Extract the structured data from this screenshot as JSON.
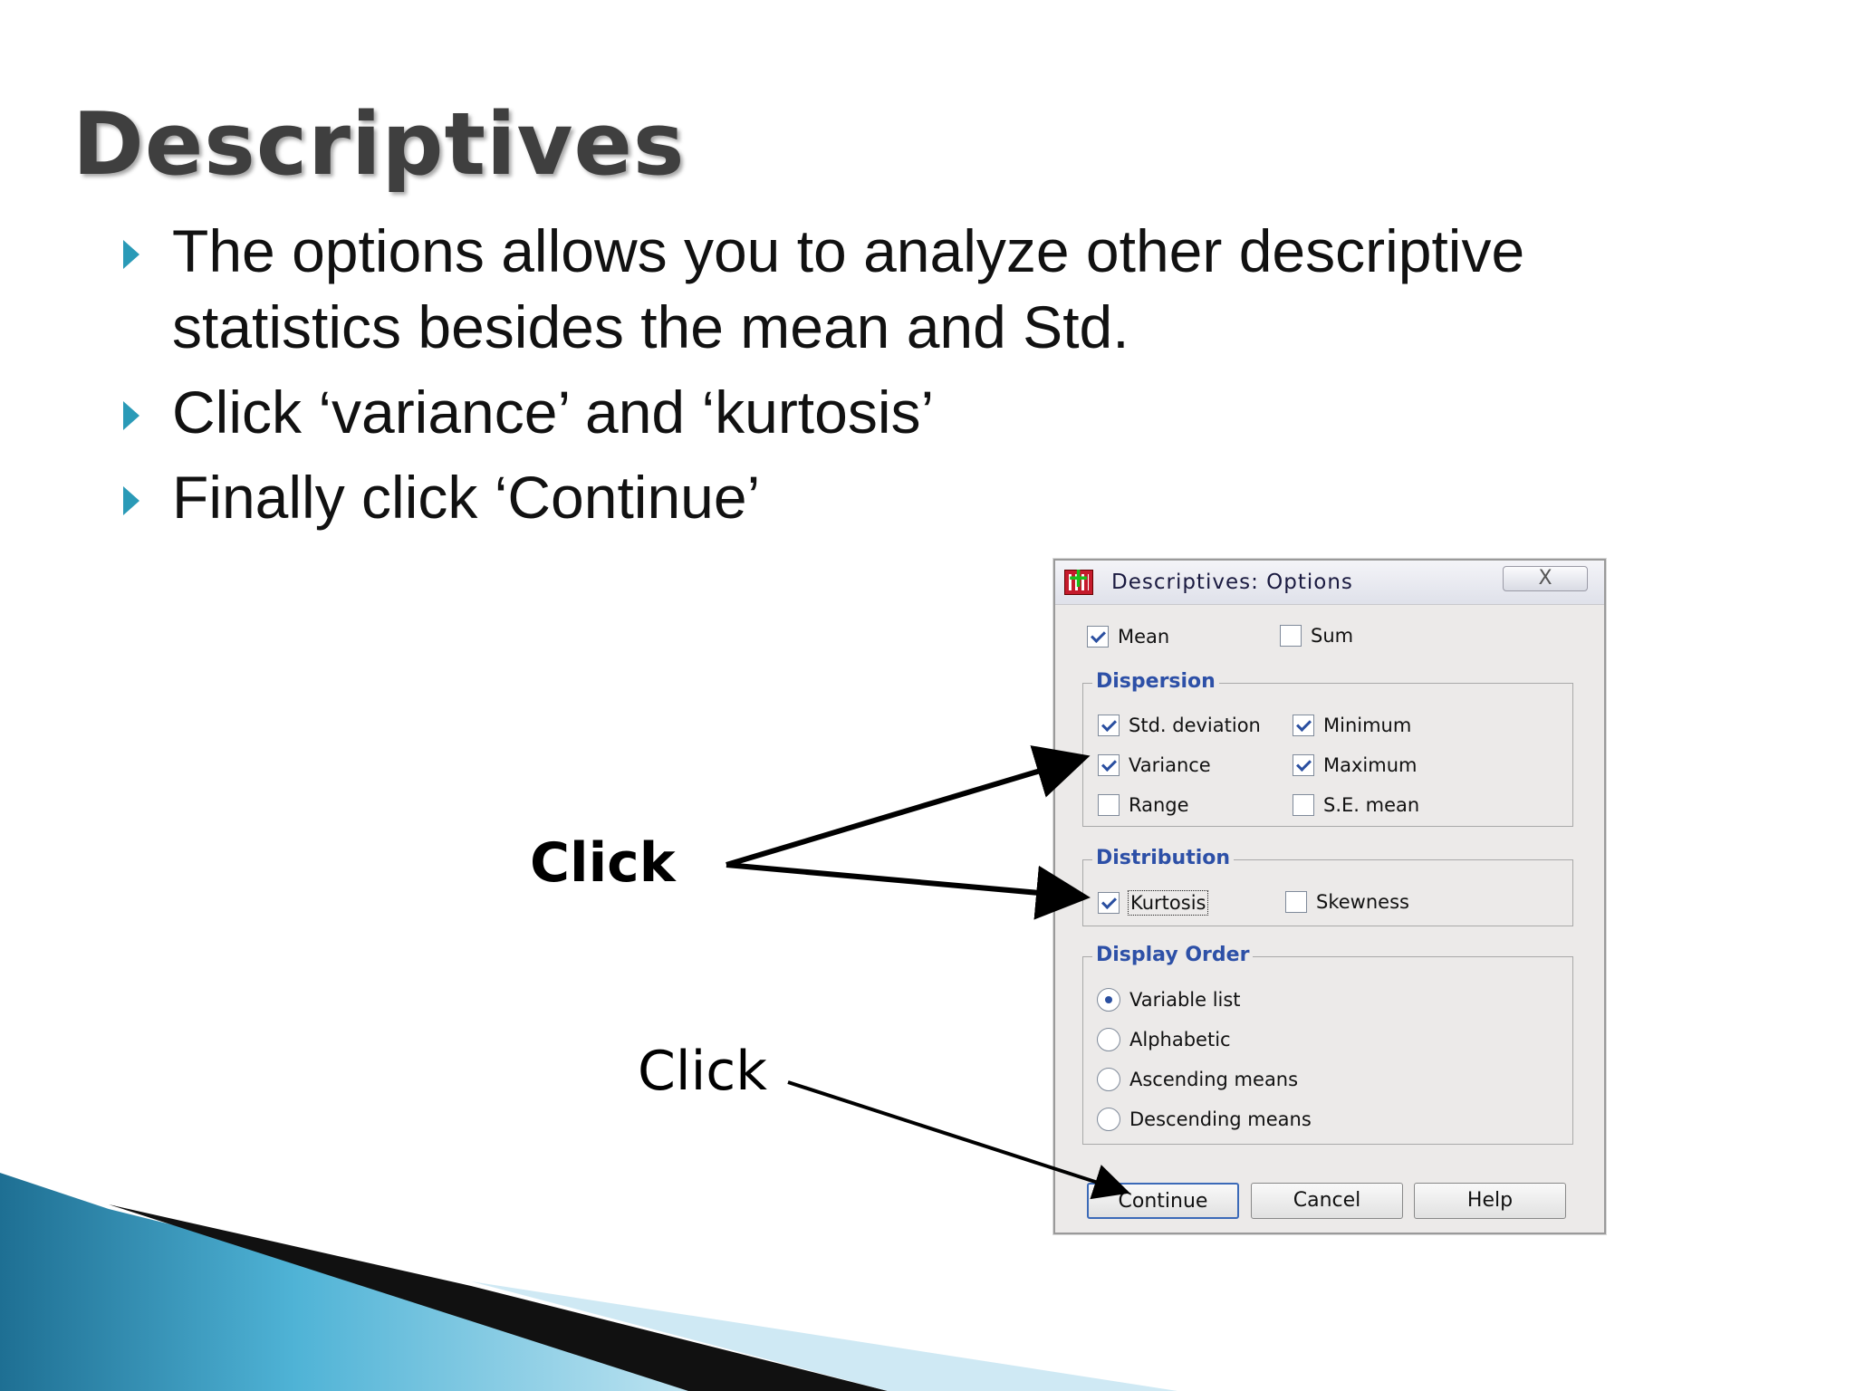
{
  "slide": {
    "title": "Descriptives",
    "bullets": [
      "The options allows you to analyze other descriptive statistics besides the mean and Std.",
      "Click ‘variance’ and ‘kurtosis’",
      "Finally click ‘Continue’"
    ],
    "annotations": [
      "Click",
      "Click"
    ]
  },
  "dialog": {
    "title": "Descriptives: Options",
    "close_label": "X",
    "mean_label": "Mean",
    "sum_label": "Sum",
    "dispersion": {
      "legend": "Dispersion",
      "std_label": "Std. deviation",
      "minimum_label": "Minimum",
      "variance_label": "Variance",
      "maximum_label": "Maximum",
      "range_label": "Range",
      "se_mean_label": "S.E. mean"
    },
    "distribution": {
      "legend": "Distribution",
      "kurtosis_label": "Kurtosis",
      "skewness_label": "Skewness"
    },
    "display_order": {
      "legend": "Display Order",
      "options": [
        "Variable list",
        "Alphabetic",
        "Ascending means",
        "Descending means"
      ]
    },
    "buttons": {
      "continue": "Continue",
      "cancel": "Cancel",
      "help": "Help"
    }
  },
  "colors": {
    "bullet": "#2a9ab7",
    "legend_text": "#2d50a7",
    "dialog_bg": "#eceae9"
  }
}
